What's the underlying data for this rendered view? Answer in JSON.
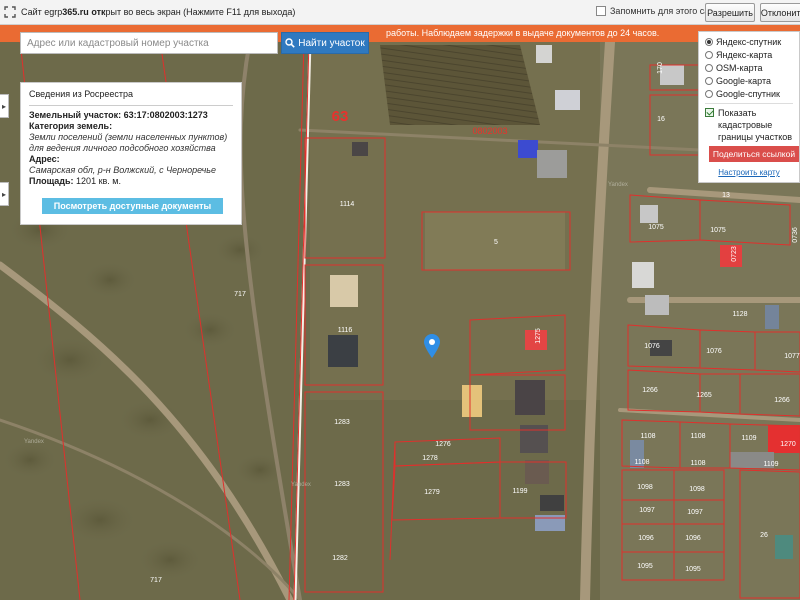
{
  "browser_bar": {
    "text_prefix": "Сайт egrp",
    "text_bold": "365.ru",
    "text_bold2": " отк",
    "text_suffix": "рыт во весь экран (Нажмите F11 для выхода)",
    "remember_label": "Запомнить для этого сайта",
    "allow_label": "Разрешить",
    "deny_label": "Отклонить"
  },
  "notice": {
    "text": "работы. Наблюдаем задержки в выдаче документов до 24 часов."
  },
  "search": {
    "placeholder": "Адрес или кадастровый номер участка",
    "button_label": "Найти участок",
    "button_icon": "search-icon"
  },
  "info_panel": {
    "title": "Сведения из Росреестра",
    "parcel_label": "Земельный участок:",
    "parcel_number": "63:17:0802003:1273",
    "category_label": "Категория земель:",
    "category_line1": "Земли поселений (земли населенных пунктов)",
    "category_line2": "для ведения личного подсобного хозяйства",
    "address_label": "Адрес:",
    "address_value": "Самарская обл, р-н Волжский, с Черноречье",
    "area_label": "Площадь:",
    "area_value": "1201 кв. м.",
    "docs_button": "Посмотреть доступные документы"
  },
  "layers_panel": {
    "options": [
      {
        "label": "Яндекс-спутник",
        "selected": true
      },
      {
        "label": "Яндекс-карта",
        "selected": false
      },
      {
        "label": "OSM-карта",
        "selected": false
      },
      {
        "label": "Google-карта",
        "selected": false
      },
      {
        "label": "Google-спутник",
        "selected": false
      }
    ],
    "show_bounds_label_1": "Показать",
    "show_bounds_label_2": "кадастровые",
    "show_bounds_label_3": "границы участков",
    "show_bounds_checked": true,
    "share_button": "Поделиться ссылкой",
    "configure_link": "Настроить карту"
  },
  "map": {
    "quarter_label": "63",
    "block_label": "0802003",
    "imagery_labels": [
      "Yandex",
      "Yandex",
      "Yandex"
    ],
    "parcel_labels": [
      "1114",
      "1116",
      "5",
      "717",
      "1283",
      "1283",
      "1282",
      "717",
      "1276",
      "1278",
      "1279",
      "1199",
      "16",
      "1075",
      "1075",
      "13",
      "1076",
      "1076",
      "1077",
      "1266",
      "1265",
      "1266",
      "1108",
      "1108",
      "1108",
      "1108",
      "1109",
      "1109",
      "1098",
      "1098",
      "1097",
      "1097",
      "1096",
      "1096",
      "1095",
      "1095",
      "26",
      "1270",
      "1275",
      "170",
      "0723",
      "0736",
      "1128"
    ],
    "colors": {
      "parcel_border": "#e0302c",
      "road": "#b09e82",
      "accent_blue": "#2f79c0",
      "notice_orange": "#ea6b33",
      "share_red": "#da4e4b",
      "docs_cyan": "#5cbde3"
    },
    "marker_icon": "map-pin-icon"
  },
  "edge_controls": [
    "▸",
    "▸"
  ]
}
